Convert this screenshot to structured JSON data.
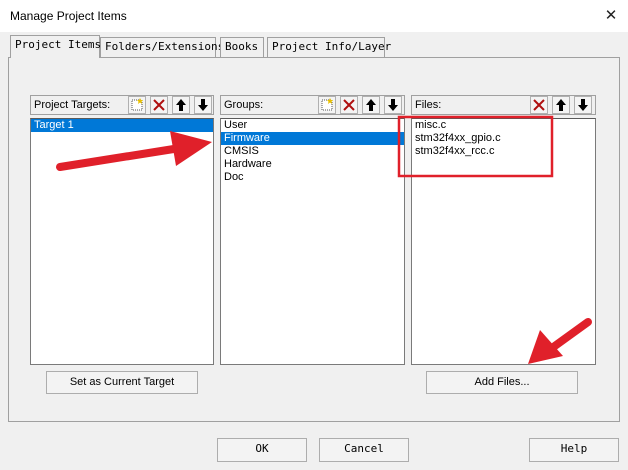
{
  "window": {
    "title": "Manage Project Items",
    "close_glyph": "✕"
  },
  "tabs": [
    {
      "label": "Project Items"
    },
    {
      "label": "Folders/Extensions"
    },
    {
      "label": "Books"
    },
    {
      "label": "Project Info/Layer"
    }
  ],
  "targets": {
    "header": "Project Targets:",
    "items": [
      "Target 1"
    ],
    "selected_index": 0
  },
  "groups": {
    "header": "Groups:",
    "items": [
      "User",
      "Firmware",
      "CMSIS",
      "Hardware",
      "Doc"
    ],
    "selected_index": 1
  },
  "files": {
    "header": "Files:",
    "items": [
      "misc.c",
      "stm32f4xx_gpio.c",
      "stm32f4xx_rcc.c"
    ]
  },
  "buttons": {
    "set_current_target": "Set as Current Target",
    "add_files": "Add Files...",
    "ok": "OK",
    "cancel": "Cancel",
    "help": "Help"
  },
  "icons": {
    "new": "new-item-icon",
    "delete": "delete-icon",
    "up": "move-up-icon",
    "down": "move-down-icon"
  },
  "colors": {
    "selection": "#0078d7",
    "annotation": "#e0202a"
  }
}
